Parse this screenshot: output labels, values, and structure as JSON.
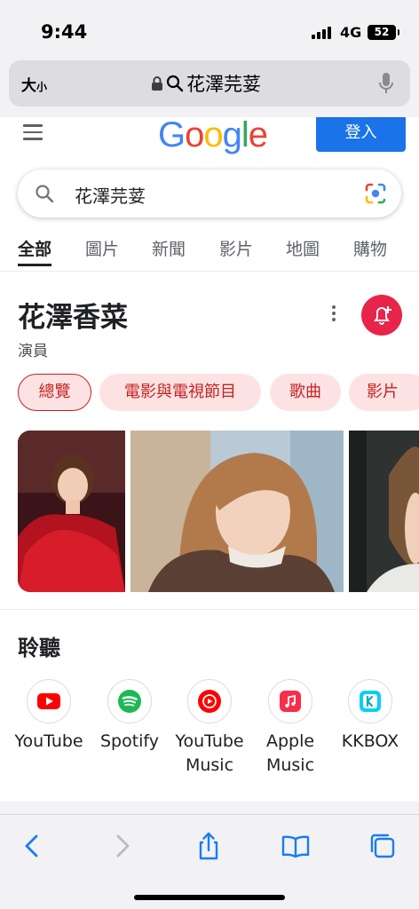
{
  "status_bar": {
    "time": "9:44",
    "network": "4G",
    "battery": "52"
  },
  "address_bar": {
    "text_size_label": "大",
    "text_size_small": "小",
    "url_text": "花澤芫荽"
  },
  "google": {
    "logo_letters": [
      {
        "ch": "G",
        "color": "#4285F4"
      },
      {
        "ch": "o",
        "color": "#EA4335"
      },
      {
        "ch": "o",
        "color": "#FBBC05"
      },
      {
        "ch": "g",
        "color": "#4285F4"
      },
      {
        "ch": "l",
        "color": "#34A853"
      },
      {
        "ch": "e",
        "color": "#EA4335"
      }
    ],
    "signin_label": "登入",
    "search_query": "花澤芫荽"
  },
  "tabs": [
    {
      "label": "全部",
      "active": true
    },
    {
      "label": "圖片"
    },
    {
      "label": "新聞"
    },
    {
      "label": "影片"
    },
    {
      "label": "地圖"
    },
    {
      "label": "購物"
    }
  ],
  "knowledge_panel": {
    "title": "花澤香菜",
    "subtitle": "演員",
    "chips": [
      {
        "label": "總覽",
        "active": true
      },
      {
        "label": "電影與電視節目"
      },
      {
        "label": "歌曲"
      },
      {
        "label": "影片"
      }
    ]
  },
  "listen": {
    "title": "聆聽",
    "services": [
      {
        "line1": "YouTube",
        "line2": "",
        "icon": "youtube-icon",
        "color": "#FF0000"
      },
      {
        "line1": "Spotify",
        "line2": "",
        "icon": "spotify-icon",
        "color": "#1DB954"
      },
      {
        "line1": "YouTube",
        "line2": "Music",
        "icon": "youtube-music-icon",
        "color": "#FF0000"
      },
      {
        "line1": "Apple",
        "line2": "Music",
        "icon": "apple-music-icon",
        "color": "#FA2D48"
      },
      {
        "line1": "KKBOX",
        "line2": "",
        "icon": "kkbox-icon",
        "color": "#09CEF6"
      }
    ]
  },
  "colors": {
    "accent_blue": "#1a73e8",
    "chip_text": "#c5221f",
    "chip_bg": "#fde2e4",
    "follow_red": "#e8244a",
    "safari_blue": "#1a7cf5"
  }
}
